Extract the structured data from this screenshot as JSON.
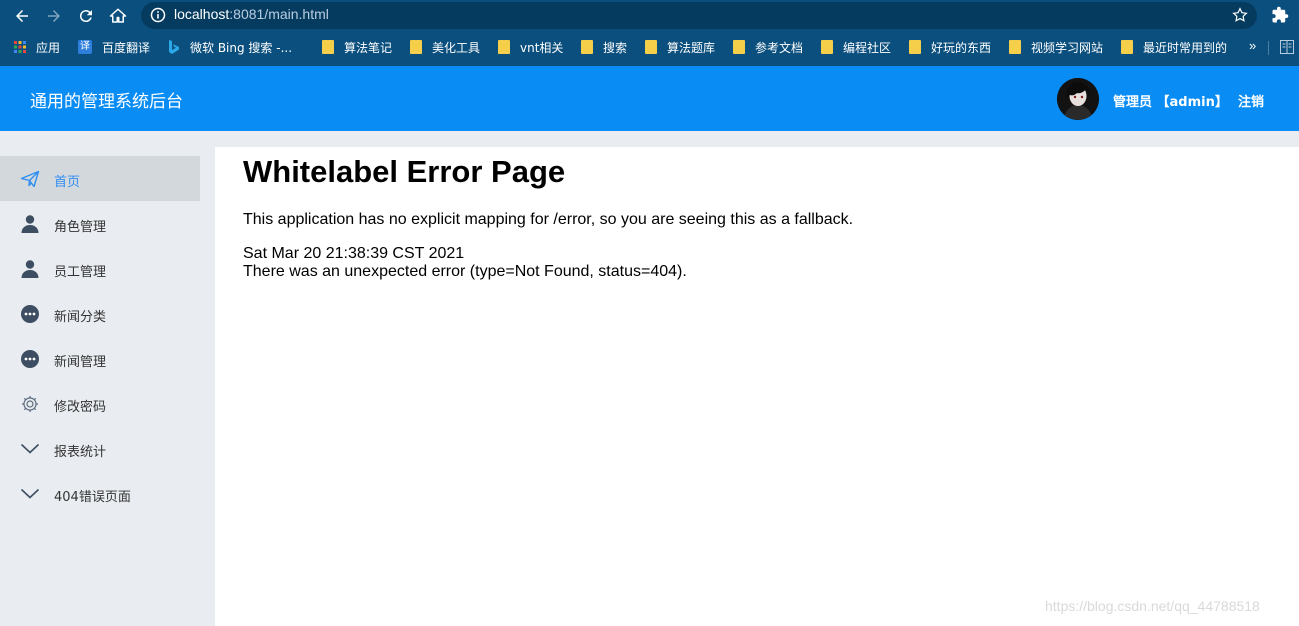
{
  "browser": {
    "url_host": "localhost",
    "url_path": ":8081/main.html",
    "bookmarks": [
      {
        "label": "应用",
        "icon": "apps-grid-icon"
      },
      {
        "label": "百度翻译",
        "icon": "translate-icon"
      },
      {
        "label": "微软 Bing 搜索 -...",
        "icon": "bing-icon"
      },
      {
        "label": "算法笔记",
        "icon": "folder-icon"
      },
      {
        "label": "美化工具",
        "icon": "folder-icon"
      },
      {
        "label": "vnt相关",
        "icon": "folder-icon"
      },
      {
        "label": "搜索",
        "icon": "folder-icon"
      },
      {
        "label": "算法题库",
        "icon": "folder-icon"
      },
      {
        "label": "参考文档",
        "icon": "folder-icon"
      },
      {
        "label": "编程社区",
        "icon": "folder-icon"
      },
      {
        "label": "好玩的东西",
        "icon": "folder-icon"
      },
      {
        "label": "视频学习网站",
        "icon": "folder-icon"
      },
      {
        "label": "最近时常用到的",
        "icon": "folder-icon"
      }
    ],
    "more_bookmarks": "»"
  },
  "header": {
    "title": "通用的管理系统后台",
    "user_label": "管理员 【admin】",
    "logout_label": "注销"
  },
  "sidebar": {
    "items": [
      {
        "label": "首页",
        "icon": "paper-plane-icon",
        "active": true
      },
      {
        "label": "角色管理",
        "icon": "user-icon"
      },
      {
        "label": "员工管理",
        "icon": "user-icon"
      },
      {
        "label": "新闻分类",
        "icon": "chat-bubble-icon"
      },
      {
        "label": "新闻管理",
        "icon": "chat-bubble-icon"
      },
      {
        "label": "修改密码",
        "icon": "gear-icon"
      },
      {
        "label": "报表统计",
        "icon": "chevron-down-icon"
      },
      {
        "label": "404错误页面",
        "icon": "chevron-down-icon"
      }
    ]
  },
  "main": {
    "title": "Whitelabel Error Page",
    "message": "This application has no explicit mapping for /error, so you are seeing this as a fallback.",
    "date": "Sat Mar 20 21:38:39 CST 2021",
    "detail": "There was an unexpected error (type=Not Found, status=404)."
  },
  "watermark": "https://blog.csdn.net/qq_44788518",
  "colors": {
    "browser_chrome": "#0b4f7e",
    "header_bg": "#0a8cf5",
    "sidebar_bg": "#e9edf1",
    "active_item_bg": "#d3d8dd",
    "active_item_text": "#2f8ef2",
    "icon_color": "#3d4e62"
  }
}
